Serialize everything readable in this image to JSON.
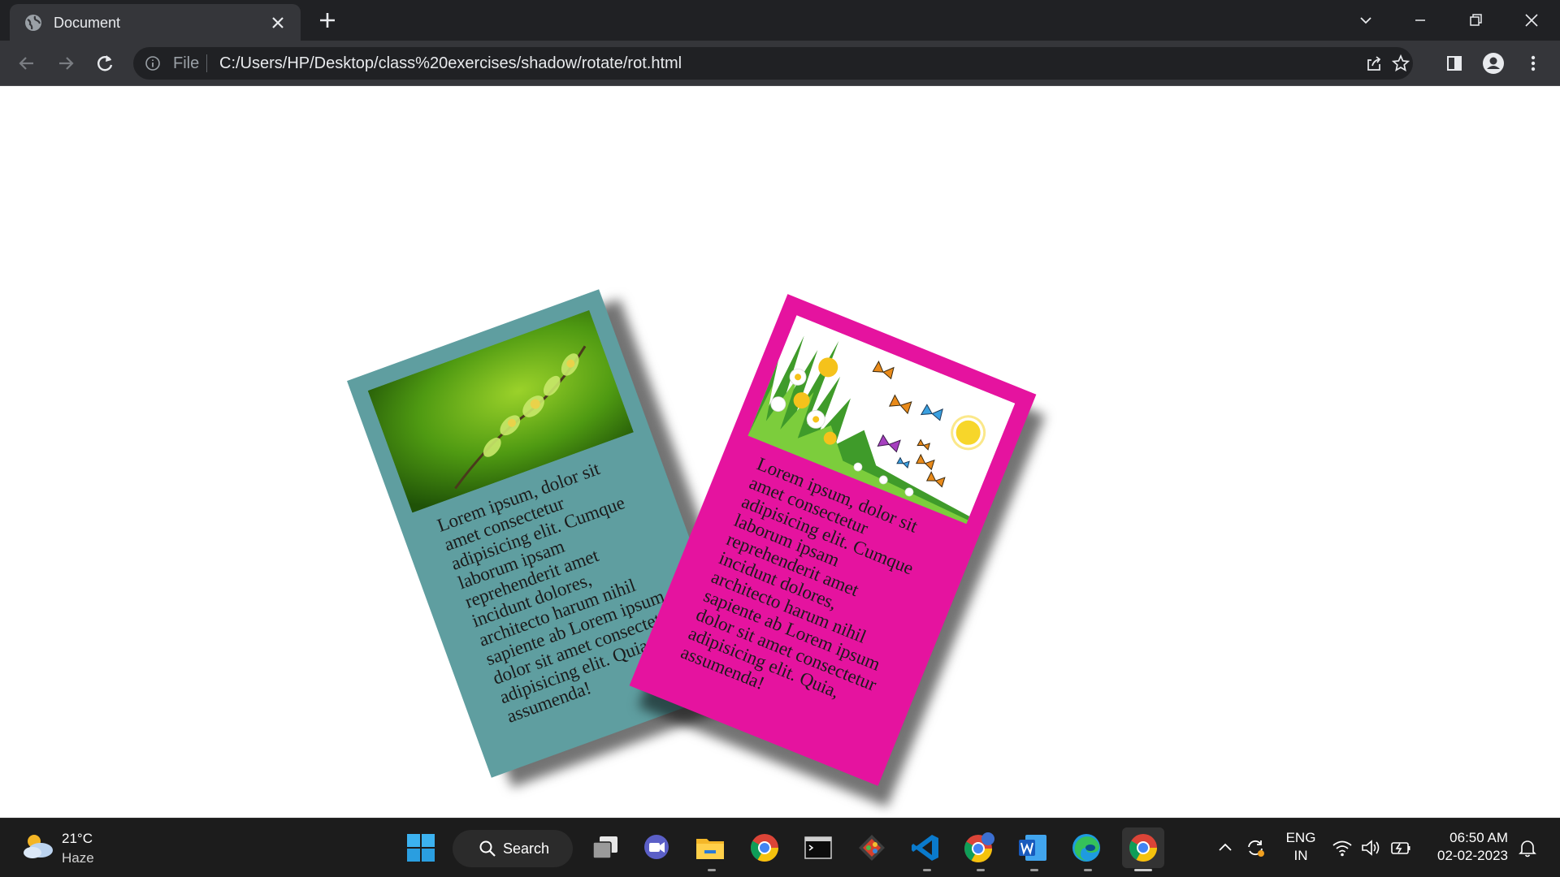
{
  "browser": {
    "tab_title": "Document",
    "url_scheme": "File",
    "url": "C:/Users/HP/Desktop/class%20exercises/shadow/rotate/rot.html"
  },
  "page": {
    "cards": [
      {
        "image": "green-branch-photo",
        "bg_color": "#5f9ea0",
        "text": "Lorem ipsum, dolor sit amet consectetur adipisicing elit. Cumque laborum ipsam reprehenderit amet incidunt dolores, architecto harum nihil sapiente ab Lorem ipsum dolor sit amet consectetur adipisicing elit. Quia, assumenda!"
      },
      {
        "image": "flowers-butterflies-illustration",
        "bg_color": "#e5139f",
        "text": "Lorem ipsum, dolor sit amet consectetur adipisicing elit. Cumque laborum ipsam reprehenderit amet incidunt dolores, architecto harum nihil sapiente ab Lorem ipsum dolor sit amet consectetur adipisicing elit. Quia, assumenda!"
      }
    ]
  },
  "taskbar": {
    "weather": {
      "temp": "21°C",
      "condition": "Haze"
    },
    "search_label": "Search",
    "apps": [
      "task-view",
      "teams",
      "file-explorer",
      "chrome",
      "terminal",
      "git",
      "vscode",
      "chrome-profile",
      "word",
      "edge",
      "chrome-active"
    ],
    "lang_line1": "ENG",
    "lang_line2": "IN",
    "time": "06:50 AM",
    "date": "02-02-2023"
  }
}
